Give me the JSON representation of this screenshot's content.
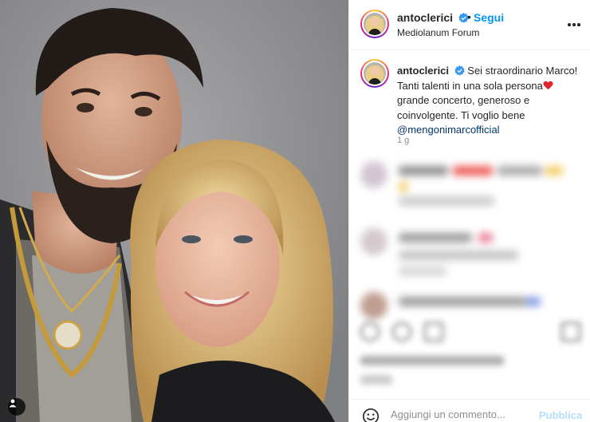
{
  "post": {
    "username": "antoclerici",
    "separator": "•",
    "follow_label": "Segui",
    "location": "Mediolanum Forum",
    "more_icon": "more-horizontal-icon",
    "verified_icon": "verified-badge-icon"
  },
  "caption": {
    "username": "antoclerici",
    "text_part1": "Sei straordinario Marco! Tanti talenti in una sola persona",
    "heart_icon": "red-heart-emoji",
    "text_part2": " grande concerto, generoso e coinvolgente. Ti voglio bene ",
    "mention": "@mengonimarcofficial",
    "time": "1 g"
  },
  "comment_box": {
    "placeholder": "Aggiungi un commento...",
    "post_label": "Pubblica",
    "emoji_icon": "emoji-smiley-icon"
  },
  "colors": {
    "accent": "#0095f6",
    "mention": "#00376b",
    "verified": "#3897f0",
    "post_disabled": "#b2dffc"
  }
}
